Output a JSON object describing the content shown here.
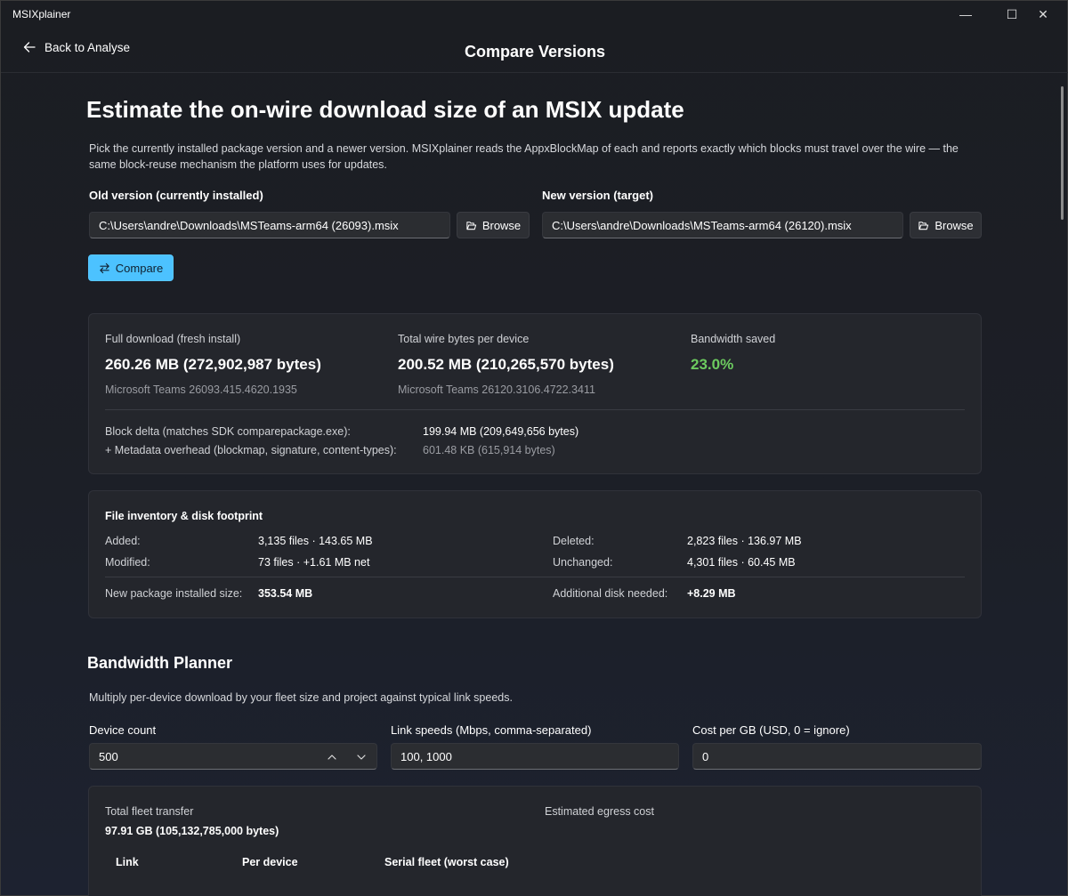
{
  "app": {
    "title": "MSIXplainer"
  },
  "window_controls": {
    "minimize": "—",
    "maximize": "☐",
    "close": "✕"
  },
  "header": {
    "back_label": "Back to Analyse",
    "title": "Compare Versions"
  },
  "intro": {
    "heading": "Estimate the on-wire download size of an MSIX update",
    "description": "Pick the currently installed package version and a newer version. MSIXplainer reads the AppxBlockMap of each and reports exactly which blocks must travel over the wire — the same block-reuse mechanism the platform uses for updates."
  },
  "old_version": {
    "label": "Old version (currently installed)",
    "path": "C:\\Users\\andre\\Downloads\\MSTeams-arm64 (26093).msix",
    "browse_label": "Browse"
  },
  "new_version": {
    "label": "New version (target)",
    "path": "C:\\Users\\andre\\Downloads\\MSTeams-arm64 (26120).msix",
    "browse_label": "Browse"
  },
  "compare_button": "Compare",
  "summary": {
    "full_label": "Full download (fresh install)",
    "full_value": "260.26 MB  (272,902,987 bytes)",
    "full_sub": "Microsoft Teams 26093.415.4620.1935",
    "wire_label": "Total wire bytes per device",
    "wire_value": "200.52 MB  (210,265,570 bytes)",
    "wire_sub": "Microsoft Teams 26120.3106.4722.3411",
    "saved_label": "Bandwidth saved",
    "saved_value": "23.0%",
    "block_delta_label": "Block delta (matches SDK comparepackage.exe):",
    "block_delta_value": "199.94 MB  (209,649,656 bytes)",
    "metadata_label": "+ Metadata overhead (blockmap, signature, content-types):",
    "metadata_value": "601.48 KB  (615,914 bytes)"
  },
  "inventory": {
    "title": "File inventory & disk footprint",
    "added_label": "Added:",
    "added_value": "3,135 files · 143.65 MB",
    "modified_label": "Modified:",
    "modified_value": "73 files · +1.61 MB net",
    "deleted_label": "Deleted:",
    "deleted_value": "2,823 files · 136.97 MB",
    "unchanged_label": "Unchanged:",
    "unchanged_value": "4,301 files · 60.45 MB",
    "installed_label": "New package installed size:",
    "installed_value": "353.54 MB",
    "disk_label": "Additional disk needed:",
    "disk_value": "+8.29 MB"
  },
  "planner": {
    "heading": "Bandwidth Planner",
    "description": "Multiply per-device download by your fleet size and project against typical link speeds.",
    "device_count_label": "Device count",
    "device_count_value": "500",
    "link_speeds_label": "Link speeds (Mbps, comma-separated)",
    "link_speeds_value": "100, 1000",
    "cost_label": "Cost per GB (USD, 0 = ignore)",
    "cost_value": "0",
    "fleet_label": "Total fleet transfer",
    "fleet_value": "97.91 GB (105,132,785,000 bytes)",
    "egress_label": "Estimated egress cost",
    "columns": [
      "Link",
      "Per device",
      "Serial fleet (worst case)"
    ]
  },
  "icons": {
    "back": "arrow-left-icon",
    "browse": "folder-open-icon",
    "compare": "swap-arrows-icon",
    "spin_up": "chevron-up-icon",
    "spin_down": "chevron-down-icon"
  },
  "colors": {
    "accent": "#4cc2ff",
    "positive": "#6ccb5f"
  }
}
